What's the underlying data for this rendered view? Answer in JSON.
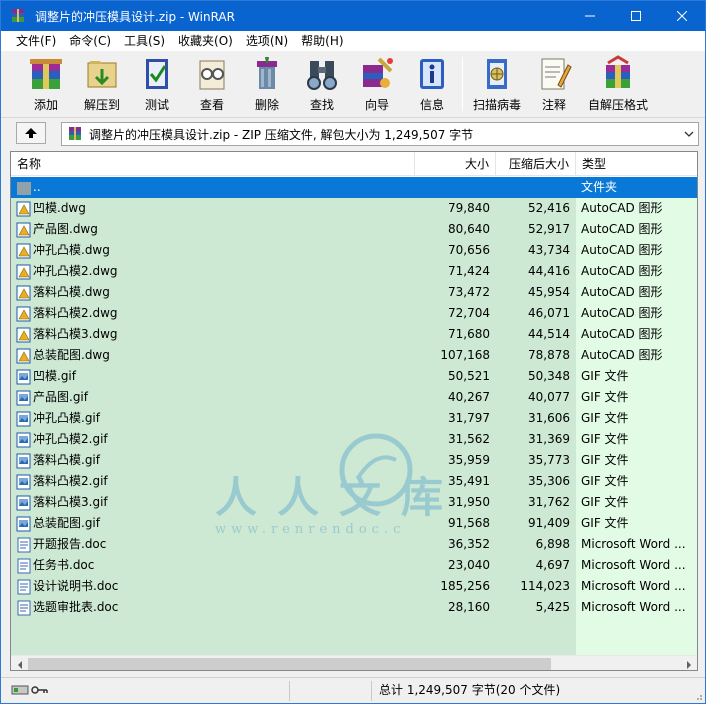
{
  "window": {
    "title": "调整片的冲压模具设计.zip - WinRAR"
  },
  "menu": [
    "文件(F)",
    "命令(C)",
    "工具(S)",
    "收藏夹(O)",
    "选项(N)",
    "帮助(H)"
  ],
  "toolbar": {
    "buttons": [
      {
        "label": "添加",
        "icon": "add-archive-icon"
      },
      {
        "label": "解压到",
        "icon": "extract-to-icon"
      },
      {
        "label": "测试",
        "icon": "test-icon"
      },
      {
        "label": "查看",
        "icon": "view-icon"
      },
      {
        "label": "删除",
        "icon": "delete-icon"
      },
      {
        "label": "查找",
        "icon": "find-binoculars-icon"
      },
      {
        "label": "向导",
        "icon": "wizard-icon"
      },
      {
        "label": "信息",
        "icon": "info-icon"
      },
      {
        "label": "扫描病毒",
        "icon": "virus-scan-icon"
      },
      {
        "label": "注释",
        "icon": "comment-icon"
      },
      {
        "label": "自解压格式",
        "icon": "sfx-icon"
      }
    ]
  },
  "address": {
    "text": "调整片的冲压模具设计.zip - ZIP 压缩文件, 解包大小为 1,249,507 字节"
  },
  "columns": {
    "name": "名称",
    "size": "大小",
    "packed": "压缩后大小",
    "type": "类型"
  },
  "files": [
    {
      "name": "..",
      "size": "",
      "packed": "",
      "type": "文件夹",
      "kind": "folder"
    },
    {
      "name": "凹模.dwg",
      "size": "79,840",
      "packed": "52,416",
      "type": "AutoCAD 图形",
      "kind": "dwg"
    },
    {
      "name": "产品图.dwg",
      "size": "80,640",
      "packed": "52,917",
      "type": "AutoCAD 图形",
      "kind": "dwg"
    },
    {
      "name": "冲孔凸模.dwg",
      "size": "70,656",
      "packed": "43,734",
      "type": "AutoCAD 图形",
      "kind": "dwg"
    },
    {
      "name": "冲孔凸模2.dwg",
      "size": "71,424",
      "packed": "44,416",
      "type": "AutoCAD 图形",
      "kind": "dwg"
    },
    {
      "name": "落料凸模.dwg",
      "size": "73,472",
      "packed": "45,954",
      "type": "AutoCAD 图形",
      "kind": "dwg"
    },
    {
      "name": "落料凸模2.dwg",
      "size": "72,704",
      "packed": "46,071",
      "type": "AutoCAD 图形",
      "kind": "dwg"
    },
    {
      "name": "落料凸模3.dwg",
      "size": "71,680",
      "packed": "44,514",
      "type": "AutoCAD 图形",
      "kind": "dwg"
    },
    {
      "name": "总装配图.dwg",
      "size": "107,168",
      "packed": "78,878",
      "type": "AutoCAD 图形",
      "kind": "dwg"
    },
    {
      "name": "凹模.gif",
      "size": "50,521",
      "packed": "50,348",
      "type": "GIF 文件",
      "kind": "gif"
    },
    {
      "name": "产品图.gif",
      "size": "40,267",
      "packed": "40,077",
      "type": "GIF 文件",
      "kind": "gif"
    },
    {
      "name": "冲孔凸模.gif",
      "size": "31,797",
      "packed": "31,606",
      "type": "GIF 文件",
      "kind": "gif"
    },
    {
      "name": "冲孔凸模2.gif",
      "size": "31,562",
      "packed": "31,369",
      "type": "GIF 文件",
      "kind": "gif"
    },
    {
      "name": "落料凸模.gif",
      "size": "35,959",
      "packed": "35,773",
      "type": "GIF 文件",
      "kind": "gif"
    },
    {
      "name": "落料凸模2.gif",
      "size": "35,491",
      "packed": "35,306",
      "type": "GIF 文件",
      "kind": "gif"
    },
    {
      "name": "落料凸模3.gif",
      "size": "31,950",
      "packed": "31,762",
      "type": "GIF 文件",
      "kind": "gif"
    },
    {
      "name": "总装配图.gif",
      "size": "91,568",
      "packed": "91,409",
      "type": "GIF 文件",
      "kind": "gif"
    },
    {
      "name": "开题报告.doc",
      "size": "36,352",
      "packed": "6,898",
      "type": "Microsoft Word ...",
      "kind": "doc"
    },
    {
      "name": "任务书.doc",
      "size": "23,040",
      "packed": "4,697",
      "type": "Microsoft Word ...",
      "kind": "doc"
    },
    {
      "name": "设计说明书.doc",
      "size": "185,256",
      "packed": "114,023",
      "type": "Microsoft Word ...",
      "kind": "doc"
    },
    {
      "name": "选题审批表.doc",
      "size": "28,160",
      "packed": "5,425",
      "type": "Microsoft Word ...",
      "kind": "doc"
    }
  ],
  "selected_row": 0,
  "watermark": {
    "text": "人人文库",
    "url": "www.renrendoc.c"
  },
  "status": {
    "text": "总计 1,249,507 字节(20 个文件)"
  },
  "colors": {
    "titlebar": "#0a64d0",
    "selection": "#0a78d7",
    "list_bg": "#cde8d3",
    "type_col_bg": "#e1fbe5"
  }
}
